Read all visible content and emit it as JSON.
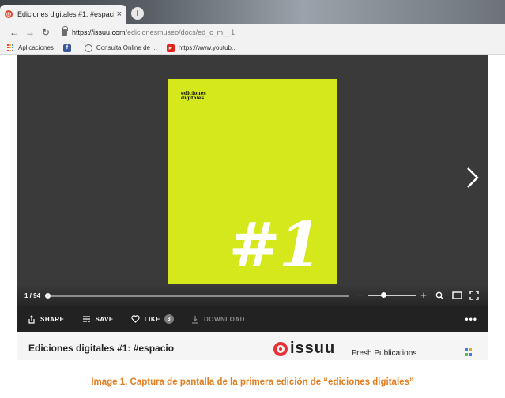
{
  "browser": {
    "tab_title": "Ediciones digitales #1: #espacio",
    "tab_close": "×",
    "new_tab": "+",
    "url_host": "https://issuu.com",
    "url_path": "/edicionesmuseo/docs/ed_c_m__1",
    "bookmarks": [
      {
        "label": "Aplicaciones",
        "icon": "apps-icon"
      },
      {
        "label": "",
        "icon": "facebook-icon"
      },
      {
        "label": "Consulta Online de ...",
        "icon": "globe-icon"
      },
      {
        "label": "https://www.youtub...",
        "icon": "youtube-icon"
      }
    ]
  },
  "viewer": {
    "cover_logo_line1": "ediciones",
    "cover_logo_line2": "digitales",
    "cover_number": "#1",
    "page_counter": "1 / 94",
    "page_progress": 0.0,
    "zoom_level": 0.3,
    "colors": {
      "background": "#3a3a3a",
      "cover": "#d5e81b"
    }
  },
  "actions": {
    "share": "SHARE",
    "save": "SAVE",
    "like": "LIKE",
    "like_count": "3",
    "download": "DOWNLOAD",
    "more": "•••"
  },
  "info": {
    "doc_title": "Ediciones digitales #1: #espacio",
    "brand": "issuu",
    "tagline": "Fresh Publications"
  },
  "caption": "Image 1. Captura de pantalla de la primera edición de “ediciones digitales”"
}
